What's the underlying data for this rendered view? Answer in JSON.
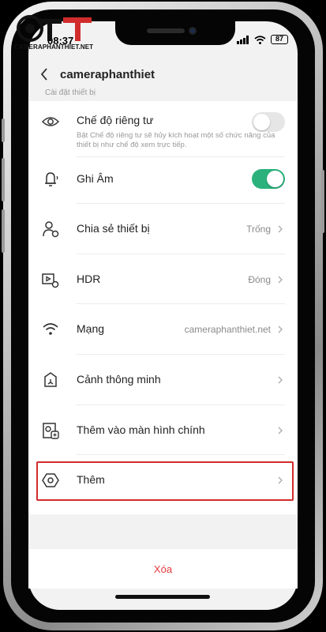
{
  "watermark": {
    "text": "CAMERAPHANTHIET.NET"
  },
  "status_bar": {
    "time": "08:37",
    "battery": "87"
  },
  "header": {
    "title": "cameraphanthiet"
  },
  "section_label": "Cài đặt thiết bị",
  "settings": {
    "privacy": {
      "label": "Chế độ riêng tư",
      "description": "Bật Chế độ riêng tư sẽ hủy kích hoạt một số chức năng của thiết bị như chế độ xem trực tiếp.",
      "enabled": false
    },
    "recording": {
      "label": "Ghi Âm",
      "enabled": true
    },
    "share": {
      "label": "Chia sẻ thiết bị",
      "value": "Trống"
    },
    "hdr": {
      "label": "HDR",
      "value": "Đóng"
    },
    "network": {
      "label": "Mạng",
      "value": "cameraphanthiet.net"
    },
    "smart_scene": {
      "label": "Cảnh thông minh"
    },
    "add_home": {
      "label": "Thêm vào màn hình chính"
    },
    "more": {
      "label": "Thêm"
    }
  },
  "delete_label": "Xóa",
  "colors": {
    "toggle_on": "#2bb27c",
    "toggle_off": "#e6e6e6",
    "delete": "#e4393c",
    "highlight": "#d12c2c"
  }
}
